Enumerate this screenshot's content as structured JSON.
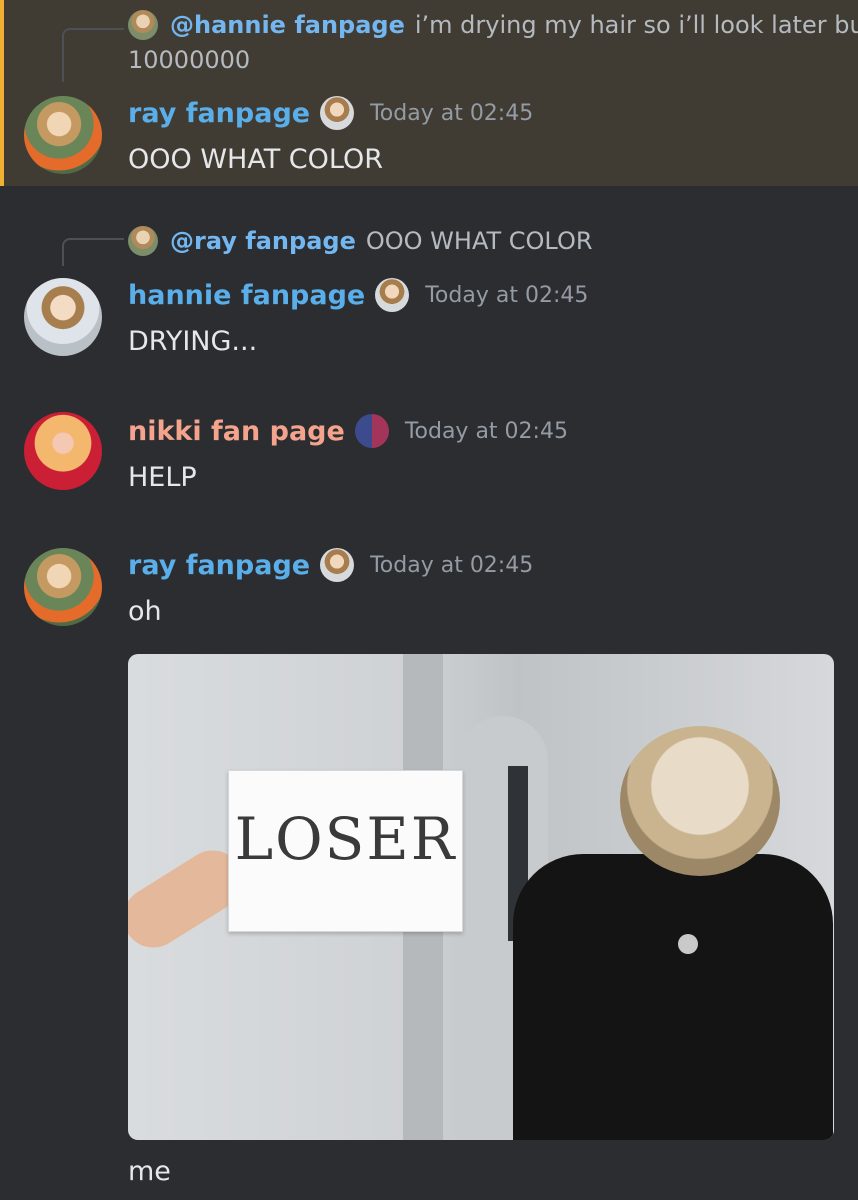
{
  "messages": [
    {
      "reply_to": {
        "mention": "@hannie fanpage",
        "text": "i’m drying my hair so i’ll look later but",
        "text_wrap": "10000000"
      },
      "author": "ray fanpage",
      "timestamp": "Today at 02:45",
      "content": "OOO WHAT COLOR",
      "highlighted": true
    },
    {
      "reply_to": {
        "mention": "@ray fanpage",
        "text": "OOO WHAT COLOR"
      },
      "author": "hannie fanpage",
      "timestamp": "Today at 02:45",
      "content": "DRYING..."
    },
    {
      "author": "nikki fan page",
      "timestamp": "Today at 02:45",
      "content": "HELP"
    },
    {
      "author": "ray fanpage",
      "timestamp": "Today at 02:45",
      "content": "oh",
      "attachment": {
        "sign_text": "LOSER"
      },
      "content_after": "me"
    }
  ],
  "colors": {
    "background": "#2b2d31",
    "highlight_bg": "#403c33",
    "highlight_border": "#f0b132",
    "username_blue": "#5aaee9",
    "username_pink": "#f4a48d",
    "timestamp": "#949ba4"
  },
  "icons": [
    "reply-spine",
    "avatar",
    "role-badge-icon"
  ]
}
